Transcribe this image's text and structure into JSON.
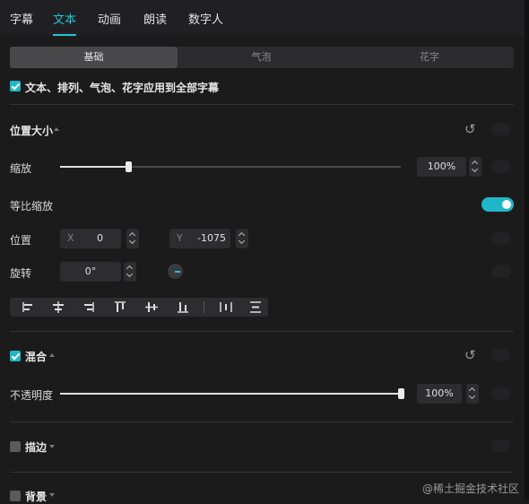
{
  "tabs": [
    "字幕",
    "文本",
    "动画",
    "朗读",
    "数字人"
  ],
  "active_tab": "文本",
  "accent": "#22c4d4",
  "subtabs": [
    "基础",
    "气泡",
    "花字"
  ],
  "apply_all": {
    "label": "文本、排列、气泡、花字应用到全部字幕",
    "checked": true
  },
  "position_size": {
    "title": "位置大小",
    "scale": {
      "label": "缩放",
      "value": "100%",
      "level": 0.2
    },
    "uniform_scale": {
      "label": "等比缩放",
      "on": true
    },
    "position": {
      "label": "位置",
      "x_label": "X",
      "x": "0",
      "y_label": "Y",
      "y": "-1075"
    },
    "rotation": {
      "label": "旋转",
      "value": "0°"
    }
  },
  "align_icons": [
    "align-left-icon",
    "align-hcenter-icon",
    "align-right-icon",
    "align-top-icon",
    "align-vcenter-icon",
    "align-bottom-icon",
    "distribute-horizontal-icon",
    "distribute-vertical-icon"
  ],
  "blend": {
    "title": "混合",
    "checked": true,
    "opacity": {
      "label": "不透明度",
      "value": "100%",
      "level": 1.0
    }
  },
  "stroke": {
    "title": "描边",
    "checked": false
  },
  "background": {
    "title": "背景",
    "checked": false
  },
  "watermark": "@稀土掘金技术社区"
}
